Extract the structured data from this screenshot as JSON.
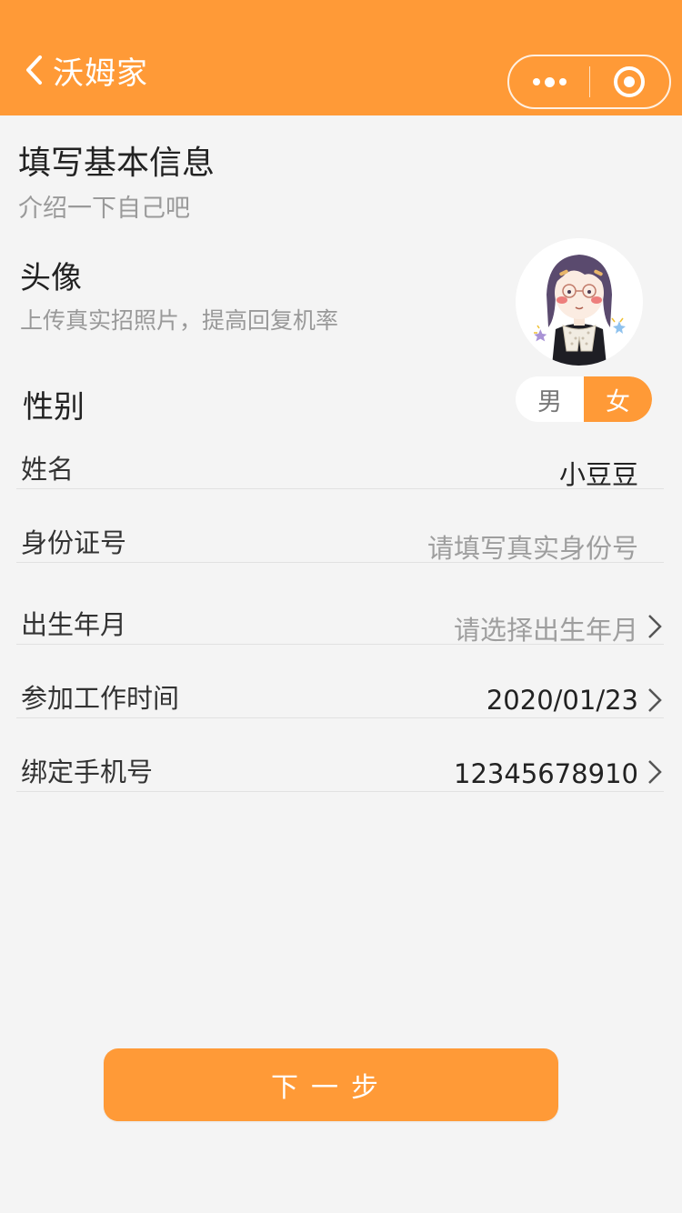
{
  "header": {
    "back_title": "沃姆家",
    "more_icon": "more-dots-icon",
    "close_icon": "target-close-icon",
    "bg_color": "#ff9a37"
  },
  "intro": {
    "title": "填写基本信息",
    "subtitle": "介绍一下自己吧"
  },
  "avatar": {
    "label": "头像",
    "hint": "上传真实招照片，提高回复机率"
  },
  "gender": {
    "label": "性别",
    "options": [
      "男",
      "女"
    ],
    "selected": "女"
  },
  "form": {
    "name": {
      "label": "姓名",
      "value": "小豆豆"
    },
    "id_number": {
      "label": "身份证号",
      "placeholder": "请填写真实身份号"
    },
    "birth": {
      "label": "出生年月",
      "placeholder": "请选择出生年月"
    },
    "work_start": {
      "label": "参加工作时间",
      "value": "2020/01/23"
    },
    "phone": {
      "label": "绑定手机号",
      "value": "12345678910"
    }
  },
  "next_button": {
    "label": "下一步"
  },
  "colors": {
    "accent": "#ff9a37",
    "background": "#f4f4f4"
  }
}
